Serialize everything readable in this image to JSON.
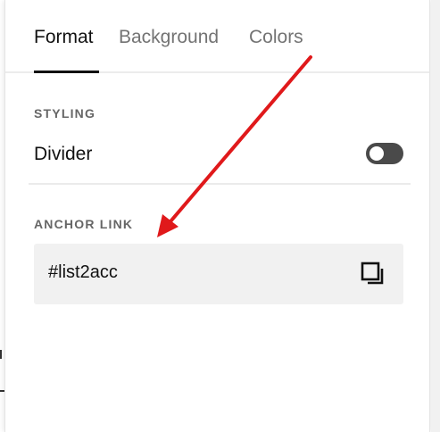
{
  "tabs": [
    {
      "label": "Format",
      "active": true
    },
    {
      "label": "Background",
      "active": false
    },
    {
      "label": "Colors",
      "active": false
    }
  ],
  "styling": {
    "section_label": "STYLING",
    "divider_label": "Divider",
    "divider_toggle_on": false
  },
  "anchor": {
    "section_label": "ANCHOR LINK",
    "value": "#list2acc",
    "copy_icon": "copy-icon"
  },
  "annotation": {
    "arrow_color": "#e0191b"
  },
  "colors": {
    "text_primary": "#111111",
    "text_muted": "#737373",
    "field_bg": "#f1f1f1",
    "toggle_off": "#4a4a4a"
  }
}
